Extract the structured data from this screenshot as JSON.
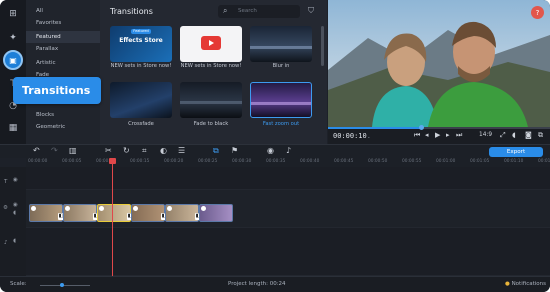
{
  "categories": [
    "All",
    "Favorites",
    "Featured",
    "Parallax",
    "Artistic",
    "Fade",
    "Blocks",
    "Geometric"
  ],
  "active_category": "Featured",
  "library": {
    "title": "Transitions",
    "search_placeholder": "Search",
    "tiles": [
      {
        "caption": "NEW sets in Store now!",
        "badge": "Featured",
        "overlay": "Effects Store"
      },
      {
        "caption": "NEW sets in Store now!"
      },
      {
        "caption": "Blur in"
      },
      {
        "caption": "Crossfade"
      },
      {
        "caption": "Fade to black"
      },
      {
        "caption": "Fast zoom out"
      }
    ]
  },
  "tooltip": "Transitions",
  "player": {
    "timecode": "00:00:10",
    "timecode_fraction": ".",
    "aspect_ratio": "14:9",
    "progress": 0.42
  },
  "toolbar": {
    "export_label": "Export"
  },
  "ruler_ticks": [
    "00:00:00",
    "00:00:05",
    "00:00:10",
    "00:00:15",
    "00:00:20",
    "00:00:25",
    "00:00:30",
    "00:00:35",
    "00:00:40",
    "00:00:45",
    "00:00:50",
    "00:00:55",
    "00:01:00",
    "00:01:05",
    "00:01:10",
    "00:01:15"
  ],
  "status": {
    "scale_label": "Scale:",
    "scale_value": 0.4,
    "project_length": "Project length: 00:24",
    "notifications": "Notifications"
  },
  "colors": {
    "accent": "#2a8ce8",
    "playhead": "#e0484a",
    "close": "#e2574c",
    "selected_clip": "#e9cc3a"
  },
  "icons": [
    "import-icon",
    "magic-wand-icon",
    "transitions-icon",
    "titles-icon",
    "stickers-icon",
    "more-tools-icon",
    "search-icon",
    "cart-icon",
    "undo-icon",
    "redo-icon",
    "delete-icon",
    "cut-icon",
    "rotate-icon",
    "crop-icon",
    "color-icon",
    "properties-icon",
    "overlay-icon",
    "marker-icon",
    "record-icon",
    "mic-icon",
    "skip-start-icon",
    "play-icon",
    "skip-end-icon",
    "fullscreen-icon",
    "volume-icon",
    "snapshot-icon"
  ]
}
